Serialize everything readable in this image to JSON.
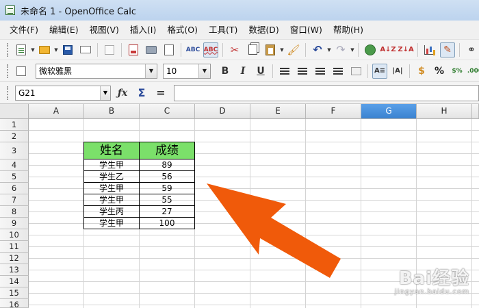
{
  "window": {
    "title": "未命名 1 - OpenOffice Calc"
  },
  "menu": [
    "文件(F)",
    "编辑(E)",
    "视图(V)",
    "插入(I)",
    "格式(O)",
    "工具(T)",
    "数据(D)",
    "窗口(W)",
    "帮助(H)"
  ],
  "format_toolbar": {
    "font_name": "微软雅黑",
    "font_size": "10"
  },
  "formula_bar": {
    "cell_ref": "G21",
    "formula": ""
  },
  "sheet": {
    "columns": [
      "A",
      "B",
      "C",
      "D",
      "E",
      "F",
      "G",
      "H"
    ],
    "selected_column": "G",
    "rows": [
      "1",
      "2",
      "3",
      "4",
      "5",
      "6",
      "7",
      "8",
      "9",
      "10",
      "11",
      "12",
      "13",
      "14",
      "15",
      "16"
    ]
  },
  "table": {
    "headers": [
      "姓名",
      "成绩"
    ],
    "rows": [
      [
        "学生甲",
        "89"
      ],
      [
        "学生乙",
        "56"
      ],
      [
        "学生甲",
        "59"
      ],
      [
        "学生甲",
        "55"
      ],
      [
        "学生丙",
        "27"
      ],
      [
        "学生甲",
        "100"
      ]
    ],
    "header_color": "#7be06a"
  },
  "annotation": {
    "arrow_color": "#f05a0a"
  },
  "watermark": {
    "brand": "Bai经验",
    "site": "jingyan.baidu.com"
  }
}
